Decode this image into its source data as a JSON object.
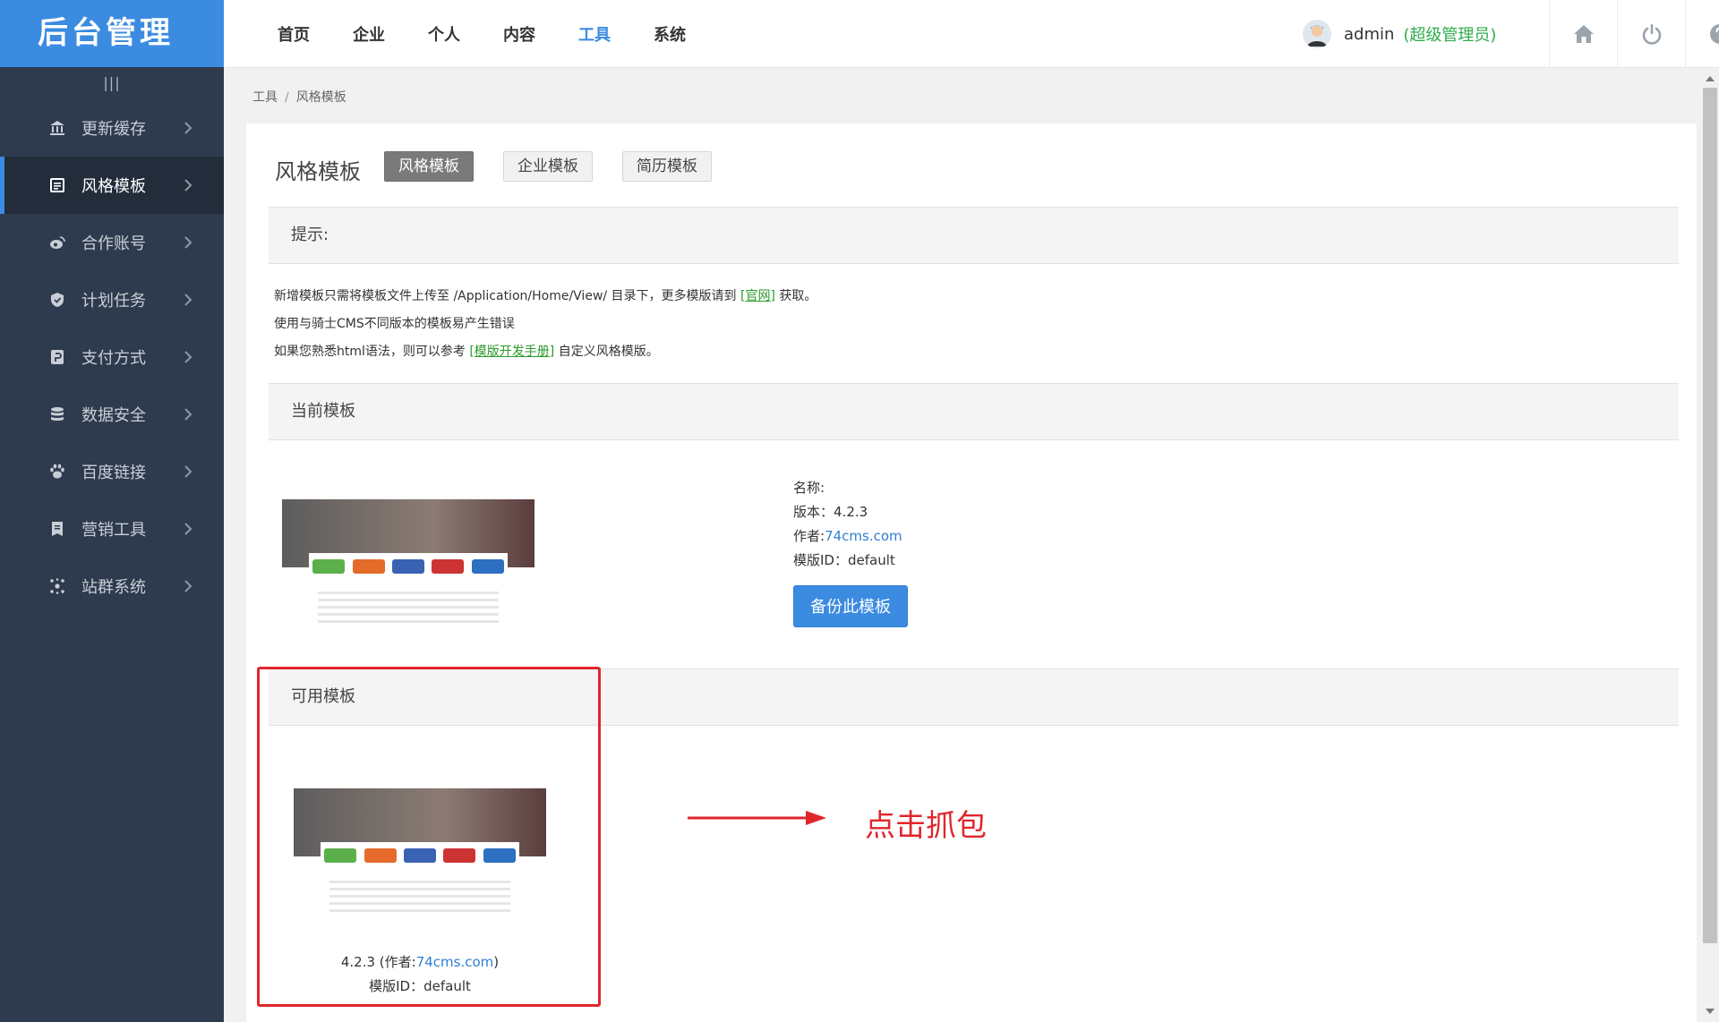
{
  "app": {
    "logo": "后台管理",
    "collapse_glyph": "|||"
  },
  "sidebar": {
    "items": [
      {
        "label": "更新缓存",
        "icon": "bank-icon"
      },
      {
        "label": "风格模板",
        "icon": "template-icon",
        "active": true
      },
      {
        "label": "合作账号",
        "icon": "weibo-icon"
      },
      {
        "label": "计划任务",
        "icon": "shield-icon"
      },
      {
        "label": "支付方式",
        "icon": "payment-icon"
      },
      {
        "label": "数据安全",
        "icon": "database-icon"
      },
      {
        "label": "百度链接",
        "icon": "paw-icon"
      },
      {
        "label": "营销工具",
        "icon": "book-icon"
      },
      {
        "label": "站群系统",
        "icon": "cluster-icon"
      }
    ]
  },
  "topnav": {
    "items": [
      "首页",
      "企业",
      "个人",
      "内容",
      "工具",
      "系统"
    ],
    "active": "工具"
  },
  "user": {
    "name": "admin",
    "role": "(超级管理员)"
  },
  "breadcrumb": {
    "parent": "工具",
    "sep": "/",
    "current": "风格模板"
  },
  "page": {
    "title": "风格模板",
    "tabs": [
      "风格模板",
      "企业模板",
      "简历模板"
    ]
  },
  "tips": {
    "heading": "提示:",
    "line1_a": "新增模板只需将模板文件上传至 /Application/Home/View/ 目录下，更多模版请到",
    "line1_link": "[官网]",
    "line1_b": "获取。",
    "line2": "使用与骑士CMS不同版本的模板易产生错误",
    "line3_a": "如果您熟悉html语法，则可以参考",
    "line3_link": "[模版开发手册]",
    "line3_b": "自定义风格模版。"
  },
  "current_template": {
    "heading": "当前模板",
    "name_label": "名称:",
    "name_value": "",
    "version_label": "版本：",
    "version_value": "4.2.3",
    "author_label": "作者:",
    "author_value": "74cms.com",
    "id_label": "模版ID：",
    "id_value": "default",
    "backup_button": "备份此模板"
  },
  "available_templates": {
    "heading": "可用模板",
    "items": [
      {
        "version": "4.2.3",
        "author_prefix": "(作者:",
        "author": "74cms.com",
        "author_suffix": ")",
        "id_label": "模版ID：",
        "id_value": "default"
      }
    ]
  },
  "annotation": {
    "text": "点击抓包",
    "color": "#e0262c"
  },
  "colors": {
    "accent": "#3b8be0",
    "sidebar": "#2e3b4e",
    "role": "#2eab4b"
  }
}
